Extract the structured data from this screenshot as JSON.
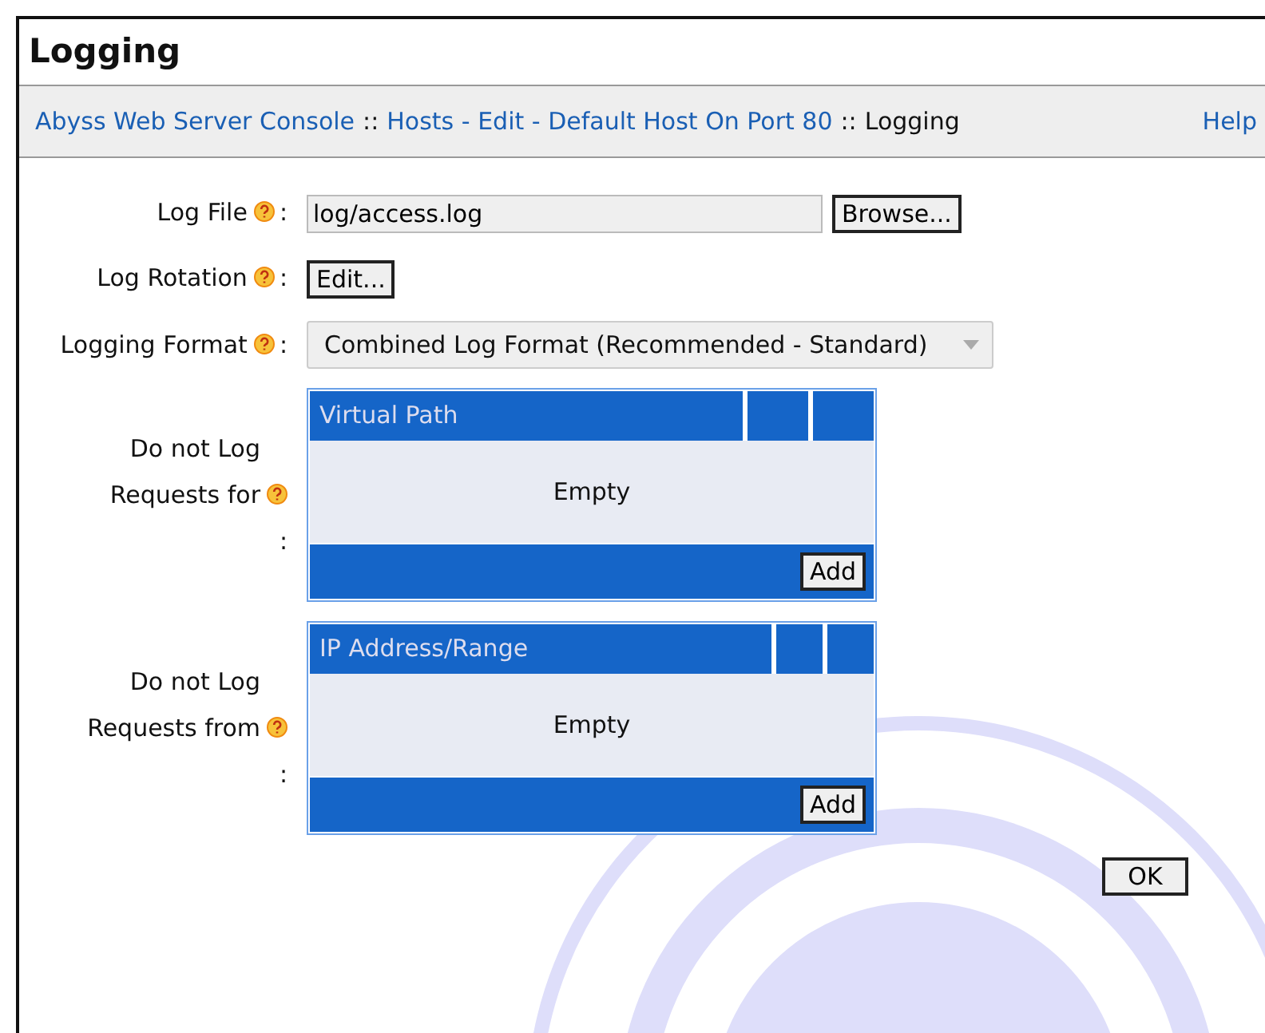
{
  "title": "Logging",
  "breadcrumb": [
    {
      "kind": "link",
      "text": "Abyss Web Server Console"
    },
    {
      "kind": "sep",
      "text": "::"
    },
    {
      "kind": "link",
      "text": "Hosts - Edit - Default Host On Port 80"
    },
    {
      "kind": "sep",
      "text": "::"
    },
    {
      "kind": "current",
      "text": "Logging"
    }
  ],
  "help": "Help",
  "fields": [
    {
      "kind": "file",
      "label": "Log File",
      "colon": ":",
      "value": "log/access.log",
      "button": "Browse..."
    },
    {
      "kind": "button",
      "label": "Log Rotation",
      "colon": ":",
      "button": "Edit..."
    },
    {
      "kind": "select",
      "label": "Logging Format",
      "colon": ":",
      "value": "Combined Log Format (Recommended - Standard)"
    },
    {
      "kind": "table",
      "label": "Do not Log Requests for",
      "colon": ":",
      "column": "Virtual Path",
      "empty": "Empty",
      "button": "Add"
    },
    {
      "kind": "table",
      "label": "Do not Log Requests from",
      "colon": ":",
      "column": "IP Address/Range",
      "empty": "Empty",
      "button": "Add"
    }
  ],
  "ok": "OK"
}
